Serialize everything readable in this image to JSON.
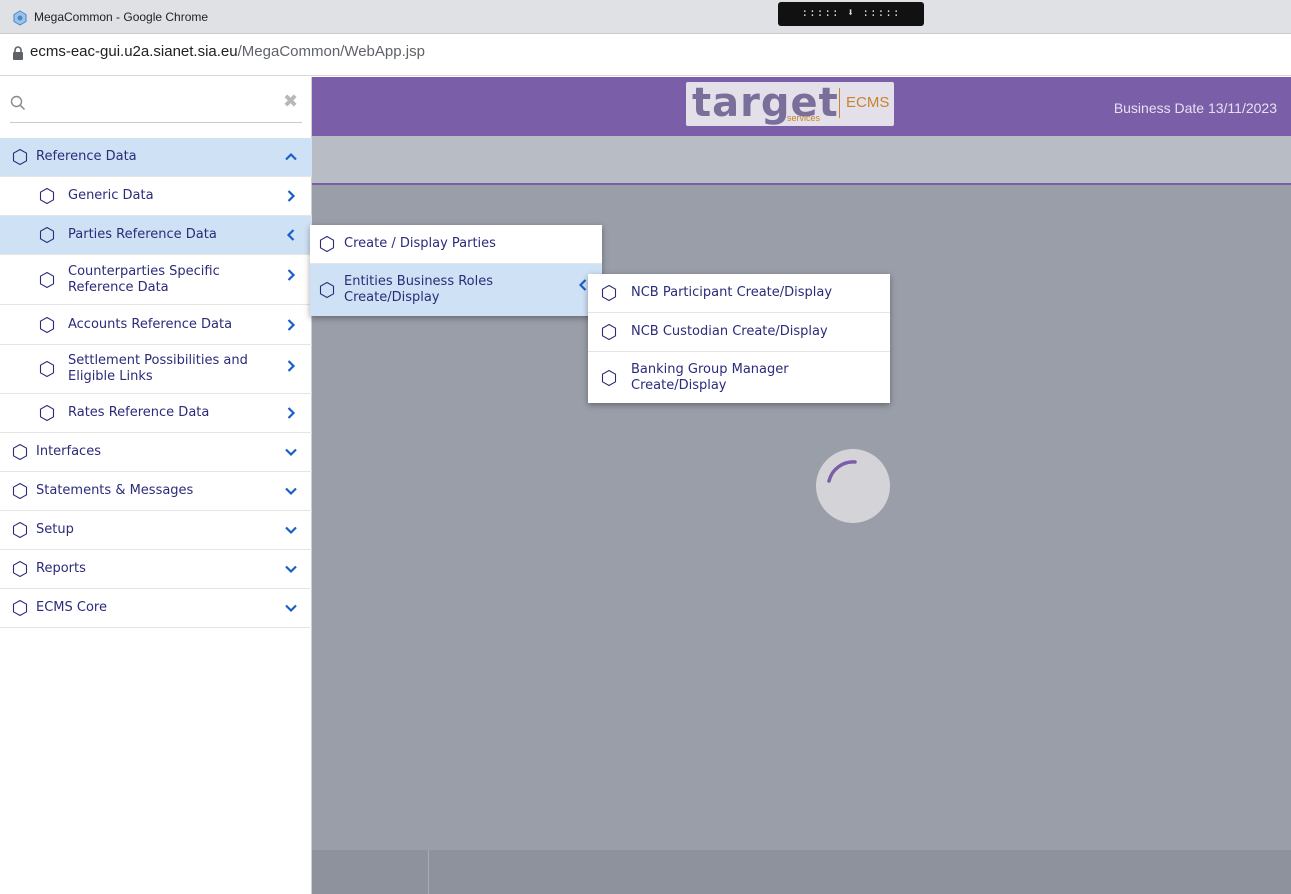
{
  "browser": {
    "window_title": "MegaCommon - Google Chrome",
    "extension_badge": "::::: ⬇ :::::",
    "url_host": "ecms-eac-gui.u2a.sianet.sia.eu",
    "url_path": "/MegaCommon/WebApp.jsp"
  },
  "header": {
    "logo_word": "target",
    "logo_sub": "services",
    "logo_product": "ECMS",
    "business_date": "Business Date 13/11/2023"
  },
  "colors": {
    "brand_purple": "#7a5fa8",
    "menu_text": "#2b2b7a",
    "selected_bg": "#cfe2f5",
    "chevron_blue": "#1a5fc8"
  },
  "search": {
    "placeholder": "",
    "value": ""
  },
  "menu": {
    "reference_data": "Reference Data",
    "generic_data": "Generic Data",
    "parties_reference_data": "Parties Reference Data",
    "counterparties_specific_line1": "Counterparties Specific",
    "counterparties_specific_line2": "Reference Data",
    "accounts_reference_data": "Accounts Reference Data",
    "settlement_line1": "Settlement Possibilities and",
    "settlement_line2": "Eligible Links",
    "rates_reference_data": "Rates Reference Data",
    "interfaces": "Interfaces",
    "statements_messages": "Statements & Messages",
    "setup": "Setup",
    "reports": "Reports",
    "ecms_core": "ECMS Core"
  },
  "flyout1": {
    "create_display_parties": "Create / Display Parties",
    "entities_line1": "Entities Business Roles",
    "entities_line2": "Create/Display"
  },
  "flyout2": {
    "ncb_participant": "NCB Participant Create/Display",
    "ncb_custodian": "NCB Custodian Create/Display",
    "banking_line1": "Banking Group Manager",
    "banking_line2": "Create/Display"
  }
}
